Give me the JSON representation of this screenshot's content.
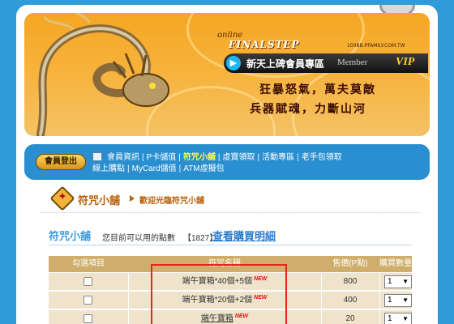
{
  "banner": {
    "brand_online": "online",
    "brand_name": "FINALSTEP",
    "site_url": "100BB.PFAMILY.COM.TW",
    "member_title": "新天上碑會員專區",
    "member_word": "Member",
    "vip_label": "VIP",
    "slogan_line1": "狂暴怒氣，萬夫莫敵",
    "slogan_line2": "兵器賦魂，力斷山河"
  },
  "nav": {
    "logout_label": "會員登出",
    "line1": [
      "會員資訊",
      "P卡儲值",
      "符咒小舖",
      "虛寶領取",
      "活動專區",
      "老手包領取"
    ],
    "line2": [
      "線上購點",
      "MyCard儲值",
      "ATM虛擬包"
    ],
    "active_item": "符咒小舖"
  },
  "breadcrumb": {
    "title": "符咒小舖",
    "subtitle": "歡迎光臨符咒小舖"
  },
  "shop": {
    "title": "符咒小舖",
    "points_label": "您目前可以用的點數",
    "points_value": "【1827】",
    "history_link": "查看購買明細"
  },
  "table": {
    "headers": [
      "勾選項目",
      "符咒名稱",
      "售價(P點)",
      "購買數量"
    ],
    "rows": [
      {
        "name": "端午寶箱*40個+5個",
        "new": "NEW",
        "price": "800",
        "qty": "1",
        "link": false
      },
      {
        "name": "端午寶箱*20個+2個",
        "new": "NEW",
        "price": "400",
        "qty": "1",
        "link": false
      },
      {
        "name": "端午寶箱",
        "new": "NEW",
        "price": "20",
        "qty": "1",
        "link": true
      }
    ]
  },
  "colors": {
    "background": "#2f9bd8",
    "nav_active": "#ffff3c",
    "table_header": "#cfae6c",
    "highlight_box": "#e8231c"
  }
}
